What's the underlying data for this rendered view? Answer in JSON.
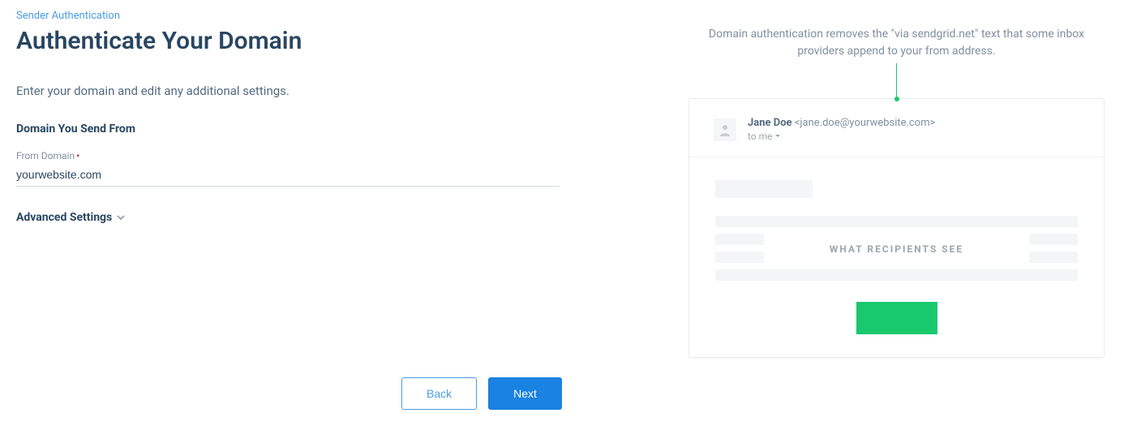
{
  "breadcrumb": "Sender Authentication",
  "page_title": "Authenticate Your Domain",
  "instruction": "Enter your domain and edit any additional settings.",
  "section_title": "Domain You Send From",
  "field": {
    "label": "From Domain",
    "placeholder": "yourwebsite.com",
    "value": ""
  },
  "advanced_settings_label": "Advanced Settings",
  "buttons": {
    "back": "Back",
    "next": "Next"
  },
  "info_text": "Domain authentication removes the \"via sendgrid.net\" text that some inbox providers append to your from address.",
  "preview": {
    "sender_name": "Jane Doe",
    "sender_email": "<jane.doe@yourwebsite.com>",
    "to_line": "to me",
    "overlay": "WHAT RECIPIENTS SEE"
  }
}
